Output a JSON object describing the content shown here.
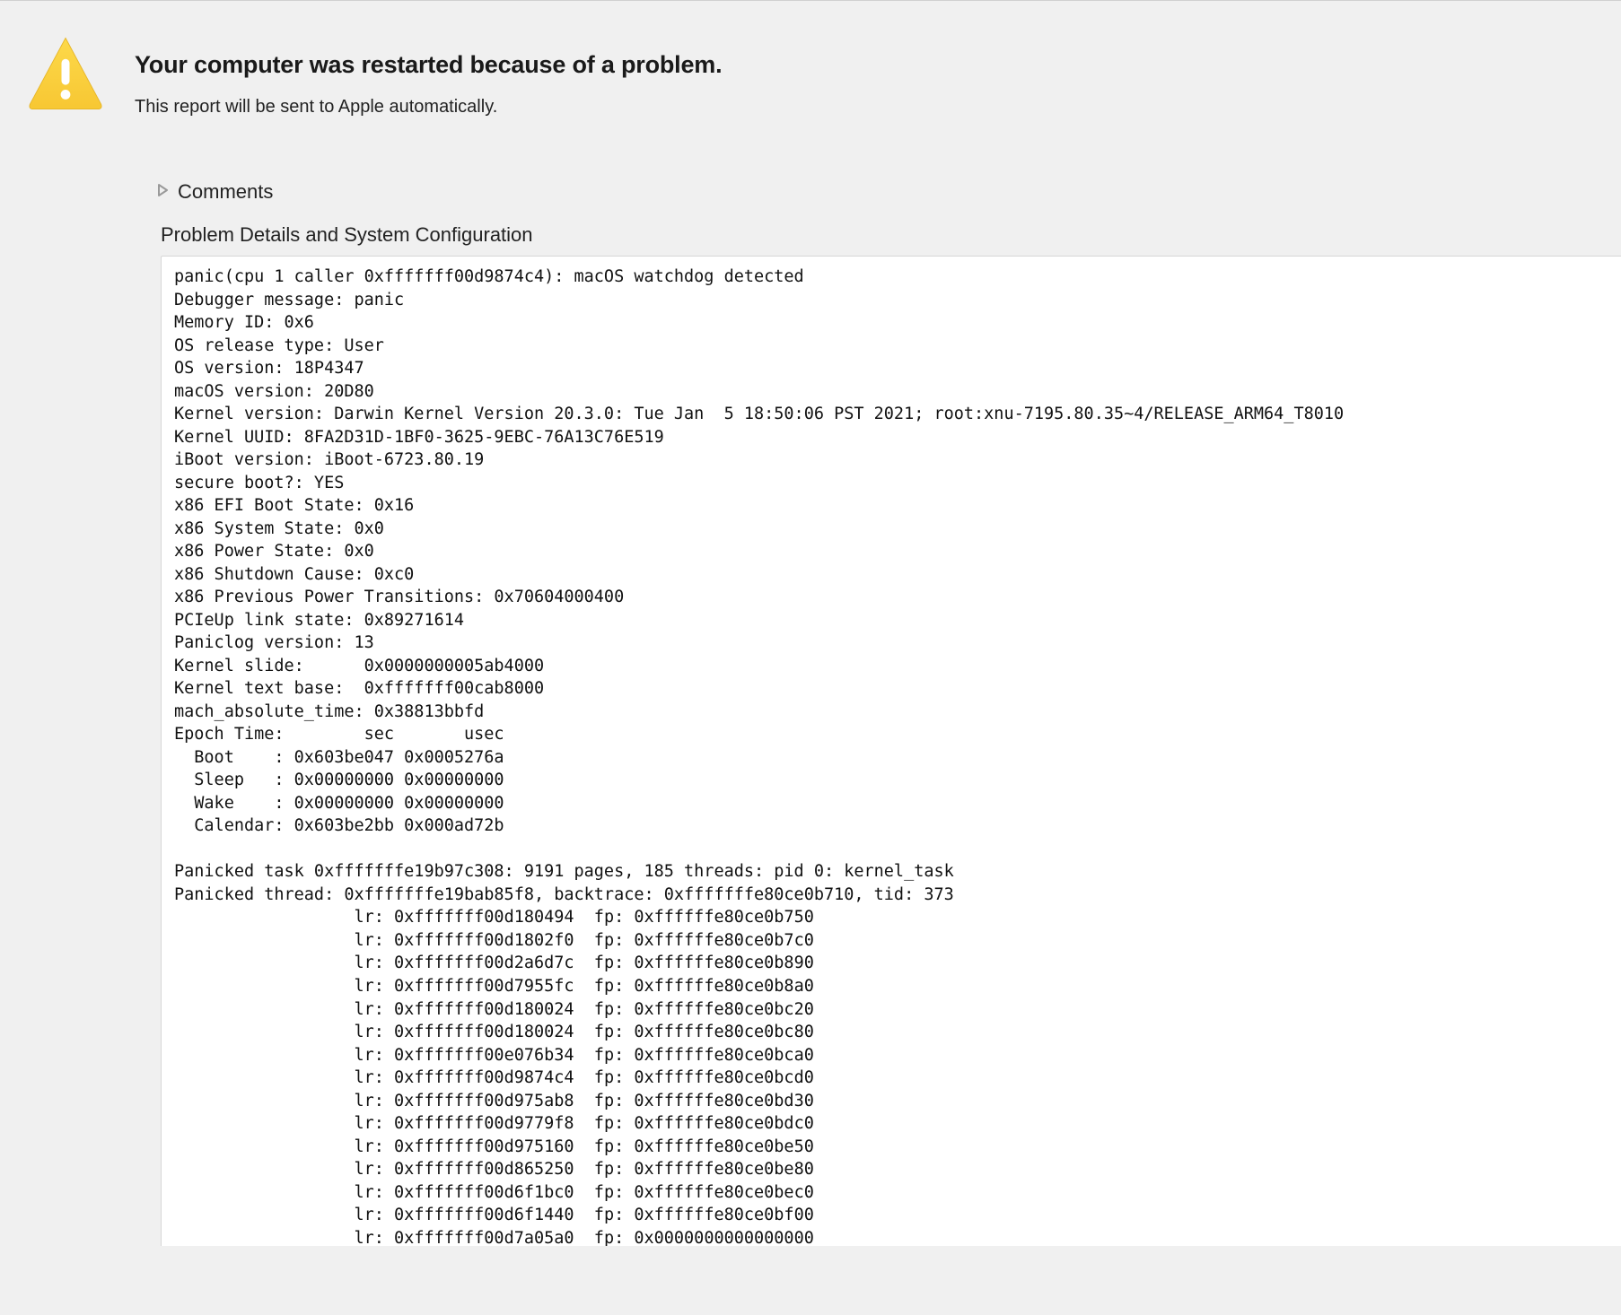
{
  "header": {
    "title": "Your computer was restarted because of a problem.",
    "subtitle": "This report will be sent to Apple automatically."
  },
  "sections": {
    "comments_label": "Comments",
    "details_label": "Problem Details and System Configuration"
  },
  "report_text": "panic(cpu 1 caller 0xfffffff00d9874c4): macOS watchdog detected\nDebugger message: panic\nMemory ID: 0x6\nOS release type: User\nOS version: 18P4347\nmacOS version: 20D80\nKernel version: Darwin Kernel Version 20.3.0: Tue Jan  5 18:50:06 PST 2021; root:xnu-7195.80.35~4/RELEASE_ARM64_T8010\nKernel UUID: 8FA2D31D-1BF0-3625-9EBC-76A13C76E519\niBoot version: iBoot-6723.80.19\nsecure boot?: YES\nx86 EFI Boot State: 0x16\nx86 System State: 0x0\nx86 Power State: 0x0\nx86 Shutdown Cause: 0xc0\nx86 Previous Power Transitions: 0x70604000400\nPCIeUp link state: 0x89271614\nPaniclog version: 13\nKernel slide:      0x0000000005ab4000\nKernel text base:  0xfffffff00cab8000\nmach_absolute_time: 0x38813bbfd\nEpoch Time:        sec       usec\n  Boot    : 0x603be047 0x0005276a\n  Sleep   : 0x00000000 0x00000000\n  Wake    : 0x00000000 0x00000000\n  Calendar: 0x603be2bb 0x000ad72b\n\nPanicked task 0xfffffffe19b97c308: 9191 pages, 185 threads: pid 0: kernel_task\nPanicked thread: 0xfffffffe19bab85f8, backtrace: 0xfffffffe80ce0b710, tid: 373\n\t\t  lr: 0xfffffff00d180494  fp: 0xffffffe80ce0b750\n\t\t  lr: 0xfffffff00d1802f0  fp: 0xffffffe80ce0b7c0\n\t\t  lr: 0xfffffff00d2a6d7c  fp: 0xffffffe80ce0b890\n\t\t  lr: 0xfffffff00d7955fc  fp: 0xffffffe80ce0b8a0\n\t\t  lr: 0xfffffff00d180024  fp: 0xffffffe80ce0bc20\n\t\t  lr: 0xfffffff00d180024  fp: 0xffffffe80ce0bc80\n\t\t  lr: 0xfffffff00e076b34  fp: 0xffffffe80ce0bca0\n\t\t  lr: 0xfffffff00d9874c4  fp: 0xffffffe80ce0bcd0\n\t\t  lr: 0xfffffff00d975ab8  fp: 0xffffffe80ce0bd30\n\t\t  lr: 0xfffffff00d9779f8  fp: 0xffffffe80ce0bdc0\n\t\t  lr: 0xfffffff00d975160  fp: 0xffffffe80ce0be50\n\t\t  lr: 0xfffffff00d865250  fp: 0xffffffe80ce0be80\n\t\t  lr: 0xfffffff00d6f1bc0  fp: 0xffffffe80ce0bec0\n\t\t  lr: 0xfffffff00d6f1440  fp: 0xffffffe80ce0bf00\n\t\t  lr: 0xfffffff00d7a05a0  fp: 0x0000000000000000"
}
